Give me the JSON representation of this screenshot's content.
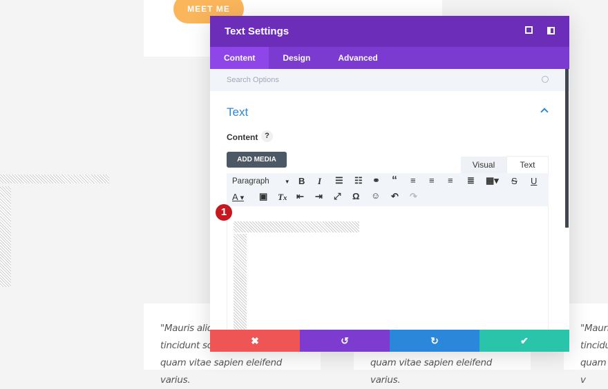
{
  "background": {
    "meet_me_label": "MEET ME",
    "quotes": [
      {
        "lines": [
          "\"Mauris aliq",
          "tincidunt so",
          "quam vitae sapien eleifend varius."
        ]
      },
      {
        "lines": [
          "",
          "",
          "quam vitae sapien eleifend varius."
        ]
      },
      {
        "lines": [
          "\"Mauri",
          "tincidu",
          "quam v"
        ]
      }
    ]
  },
  "modal": {
    "title": "Text Settings",
    "header_icons": [
      "fullscreen-icon",
      "sidebar-toggle-icon"
    ],
    "tabs": [
      {
        "label": "Content",
        "active": true
      },
      {
        "label": "Design"
      },
      {
        "label": "Advanced"
      }
    ],
    "search_placeholder": "Search Options",
    "section_title": "Text",
    "content_label": "Content",
    "help": "?",
    "add_media": "ADD MEDIA",
    "editor_tabs": {
      "visual": "Visual",
      "text": "Text",
      "active": "Text"
    },
    "format_select": "Paragraph",
    "step_badge": "1",
    "footer": {
      "cancel": "✖",
      "undo": "↺",
      "redo": "↻",
      "save": "✔",
      "colors": {
        "cancel": "#ef5555",
        "undo": "#7d3bcf",
        "redo": "#2b87da",
        "save": "#29c4a9"
      }
    }
  },
  "colors": {
    "header": "#6c2eb9",
    "tabs": "#7b3bd0",
    "active_tab": "#8f46e8",
    "meet_me": "#fbb65b",
    "section_title": "#2b87da"
  }
}
